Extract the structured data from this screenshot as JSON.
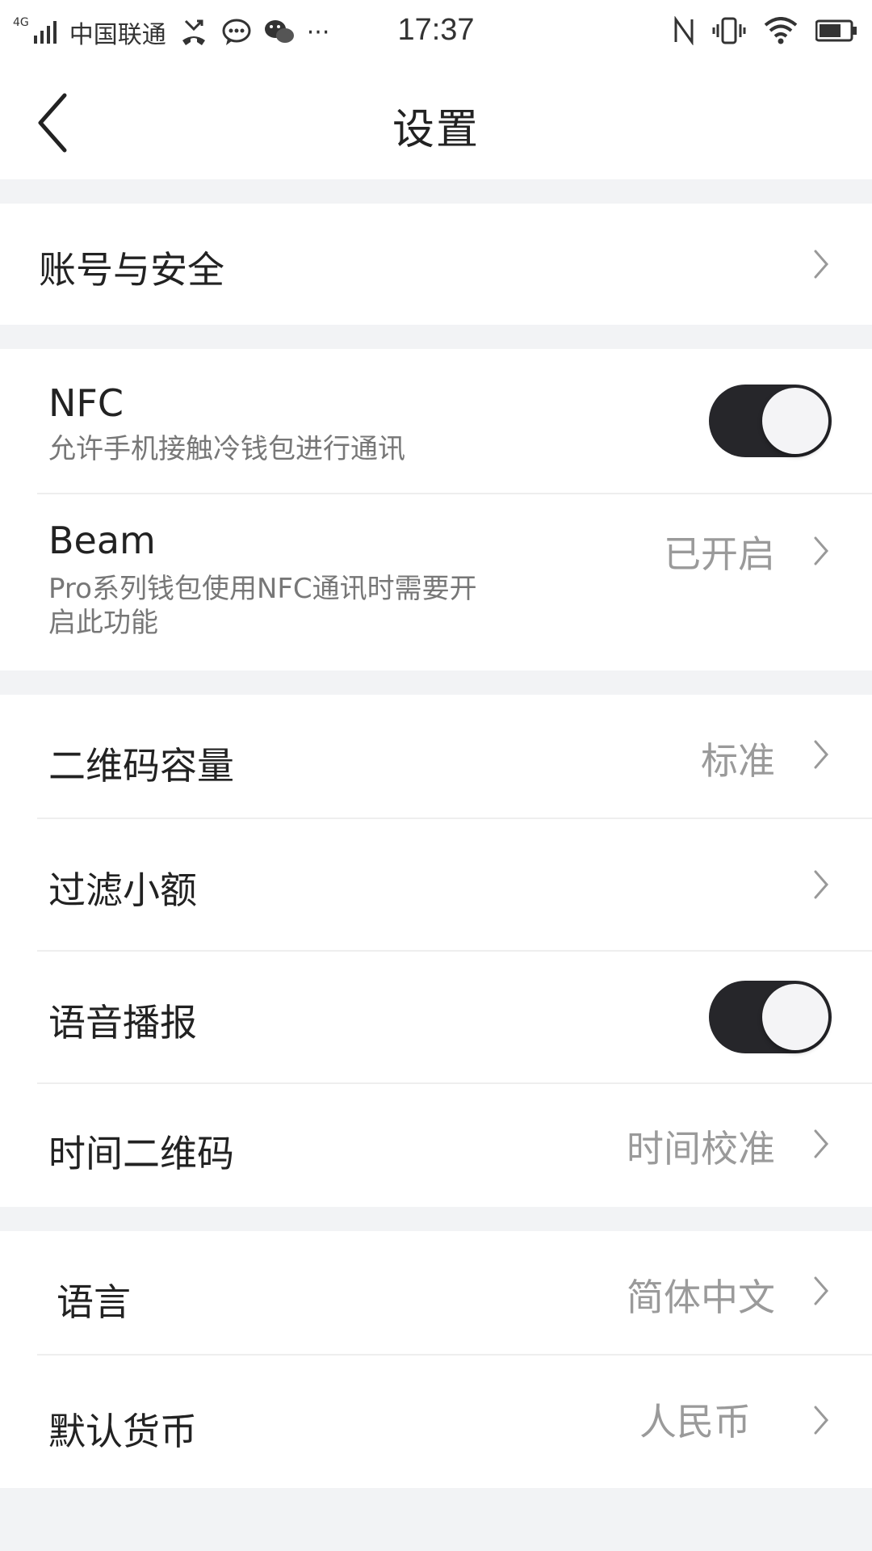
{
  "status_bar": {
    "network": "4G",
    "carrier": "中国联通",
    "more": "···",
    "time": "17:37"
  },
  "header": {
    "title": "设置",
    "back_icon": "chevron-left-icon"
  },
  "groups": {
    "account": {
      "label": "账号与安全"
    },
    "nfc": {
      "label": "NFC",
      "desc": "允许手机接触冷钱包进行通讯",
      "enabled": true
    },
    "beam": {
      "label": "Beam",
      "desc": "Pro系列钱包使用NFC通讯时需要开启此功能",
      "value": "已开启"
    },
    "qr_capacity": {
      "label": "二维码容量",
      "value": "标准"
    },
    "filter_small": {
      "label": "过滤小额"
    },
    "voice": {
      "label": "语音播报",
      "enabled": true
    },
    "time_qr": {
      "label": "时间二维码",
      "value": "时间校准"
    },
    "language": {
      "label": "语言",
      "value": "简体中文"
    },
    "currency": {
      "label": "默认货币",
      "value": "人民币"
    }
  },
  "colors": {
    "toggle_on": "#26262a",
    "background": "#f2f3f5",
    "secondary_text": "#9a9a9a"
  }
}
